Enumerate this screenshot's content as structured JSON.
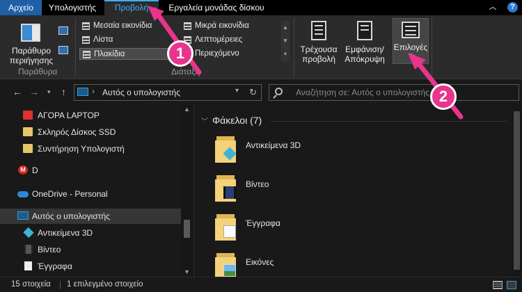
{
  "tabs": {
    "file": "Αρχείο",
    "computer": "Υπολογιστής",
    "view": "Προβολή",
    "drive_tools": "Εργαλεία μονάδας δίσκου"
  },
  "ribbon": {
    "pane_button": "Παράθυρο περιήγησης",
    "panes_group": "Παράθυρα",
    "layout_group": "Διάταξη",
    "layout_items": {
      "medium_icons": "Μεσαία εικονίδια",
      "list": "Λίστα",
      "tiles": "Πλακίδια",
      "small_icons": "Μικρά εικονίδια",
      "details": "Λεπτομέρειες",
      "content": "Περιεχόμενο"
    },
    "current_view": "Τρέχουσα προβολή",
    "show_hide": "Εμφάνιση/ Απόκρυψη",
    "options": "Επιλογές"
  },
  "annotations": {
    "badge1": "1",
    "badge2": "2"
  },
  "address": {
    "path": "Αυτός ο υπολογιστής",
    "search_placeholder": "Αναζήτηση σε: Αυτός ο υπολογιστής"
  },
  "nav": {
    "items": [
      "ΑΓΟΡΑ LAPTOP",
      "Σκληρός Δίσκος SSD",
      "Συντήρηση Υπολογιστή",
      "D",
      "OneDrive - Personal",
      "Αυτός ο υπολογιστής",
      "Αντικείμενα 3D",
      "Βίντεο",
      "Έγγραφα"
    ]
  },
  "content": {
    "group_title": "Φάκελοι (7)",
    "folders": [
      "Αντικείμενα 3D",
      "Βίντεο",
      "Έγγραφα",
      "Εικόνες"
    ]
  },
  "status": {
    "items_count": "15 στοιχεία",
    "selected": "1 επιλεγμένο στοιχείο"
  },
  "colors": {
    "accent": "#3ab0ff",
    "annotation_pink": "#e8348d",
    "file_tab": "#1f5fa6"
  }
}
